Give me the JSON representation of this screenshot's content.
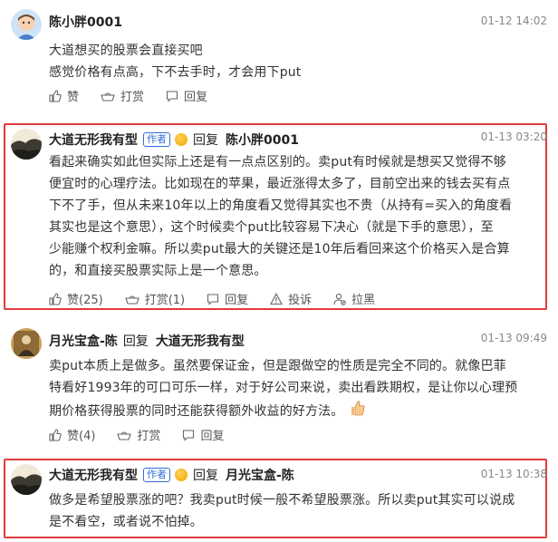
{
  "comments": [
    {
      "user": "陈小胖0001",
      "time": "01-12 14:02",
      "lines": [
        "大道想买的股票会直接买吧",
        "感觉价格有点高，下不去手时，才会用下put"
      ],
      "actions": {
        "like": "赞",
        "tip": "打赏",
        "reply": "回复"
      }
    },
    {
      "user": "大道无形我有型",
      "author_tag": "作者",
      "reply_word": "回复",
      "reply_to": "陈小胖0001",
      "time": "01-13 03:20",
      "lines": [
        "看起来确实如此但实际上还是有一点点区别的。卖put有时候就是想买又觉得不够",
        "便宜时的心理疗法。比如现在的苹果，最近涨得太多了，目前空出来的钱去买有点",
        "下不了手，但从未来10年以上的角度看又觉得其实也不贵（从持有=买入的角度看",
        "其实也是这个意思），这个时候卖个put比较容易下决心（就是下手的意思），至",
        "少能赚个权利金嘛。所以卖put最大的关键还是10年后看回来这个价格买入是合算",
        "的，和直接买股票实际上是一个意思。"
      ],
      "actions": {
        "like": "赞(25)",
        "tip": "打赏(1)",
        "reply": "回复",
        "report": "投诉",
        "block": "拉黑"
      }
    },
    {
      "user": "月光宝盒-陈",
      "reply_word": "回复",
      "reply_to": "大道无形我有型",
      "time": "01-13 09:49",
      "lines": [
        "卖put本质上是做多。虽然要保证金，但是跟做空的性质是完全不同的。就像巴菲",
        "特看好1993年的可口可乐一样，对于好公司来说，卖出看跌期权，是让你以心理预",
        "期价格获得股票的同时还能获得额外收益的好方法。"
      ],
      "actions": {
        "like": "赞(4)",
        "tip": "打赏",
        "reply": "回复"
      }
    },
    {
      "user": "大道无形我有型",
      "author_tag": "作者",
      "reply_word": "回复",
      "reply_to": "月光宝盒-陈",
      "time": "01-13 10:38",
      "lines": [
        "做多是希望股票涨的吧？我卖put时候一般不希望股票涨。所以卖put其实可以说成",
        "是不看空，或者说不怕掉。"
      ]
    }
  ],
  "colors": {
    "highlight_border": "#e03c3c",
    "author_tag": "#2f6fd6",
    "time": "#888888"
  }
}
